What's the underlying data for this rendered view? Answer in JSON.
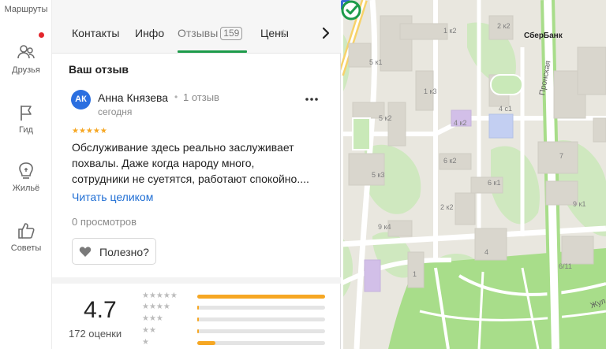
{
  "rail": {
    "items": [
      {
        "label": "Маршруты",
        "icon": "route-icon"
      },
      {
        "label": "Друзья",
        "icon": "friends-icon"
      },
      {
        "label": "Гид",
        "icon": "flag-icon"
      },
      {
        "label": "Жильё",
        "icon": "housing-icon"
      },
      {
        "label": "Советы",
        "icon": "thumbs-up-icon"
      }
    ]
  },
  "tabs": {
    "items": [
      "Контакты",
      "Инфо",
      "Отзывы",
      "Цены",
      "Ф"
    ],
    "reviews_count": "159",
    "active": "Отзывы"
  },
  "review": {
    "section_title": "Ваш отзыв",
    "avatar_initials": "АК",
    "author": "Анна Князева",
    "author_reviews": "1 отзыв",
    "date": "сегодня",
    "stars": "★★★★★",
    "text_lines": [
      "Обслуживание здесь реально заслуживает",
      "похвалы. Даже когда народу много,",
      "сотрудники не суетятся, работают спокойно...."
    ],
    "read_more": "Читать целиком",
    "views": "0 просмотров",
    "useful_label": "Полезно?"
  },
  "rating": {
    "value": "4.7",
    "count": "172 оценки",
    "histogram": [
      {
        "stars": "★★★★★",
        "fraction": 1.0
      },
      {
        "stars": "★★★★",
        "fraction": 0.015
      },
      {
        "stars": "★★★",
        "fraction": 0.015
      },
      {
        "stars": "★★",
        "fraction": 0.015
      },
      {
        "stars": "★",
        "fraction": 0.14
      }
    ]
  },
  "map": {
    "bank_name": "СберБанк",
    "street_name_1": "Пронская",
    "street_name_2": "Жул",
    "labels": [
      "2 к2",
      "1 к2",
      "5 к1",
      "1 к3",
      "4 с1",
      "5 к2",
      "4 к2",
      "6 к2",
      "7",
      "5 к3",
      "6 к1",
      "2 к2",
      "9 к1",
      "9 к4",
      "4",
      "1",
      "6/11"
    ],
    "colors": {
      "road": "#ffffff",
      "park": "#c9e9b8",
      "park_bright": "#a8dd8a",
      "building": "#d9d6cd",
      "blue_building": "#c3cff2",
      "purple_building": "#d2bfe8",
      "main_road": "#f7d26a",
      "accent": "#1d9b4a"
    }
  }
}
